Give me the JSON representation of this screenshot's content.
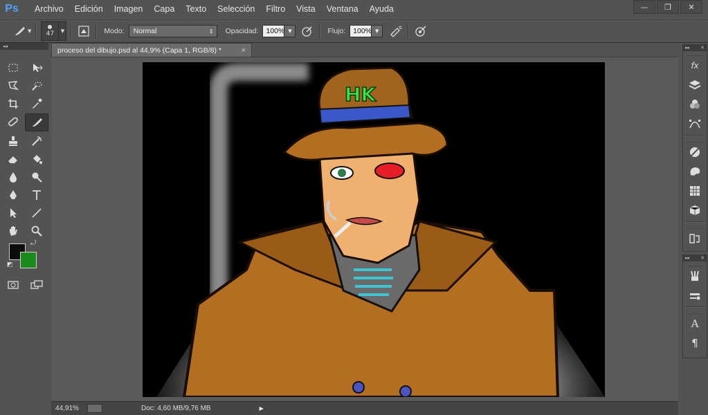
{
  "app": {
    "logo": "Ps"
  },
  "menu": [
    "Archivo",
    "Edición",
    "Imagen",
    "Capa",
    "Texto",
    "Selección",
    "Filtro",
    "Vista",
    "Ventana",
    "Ayuda"
  ],
  "window_controls": {
    "minimize": "—",
    "restore": "❐",
    "close": "✕"
  },
  "options_bar": {
    "brush_size": "47",
    "mode_label": "Modo:",
    "mode_value": "Normal",
    "opacity_label": "Opacidad:",
    "opacity_value": "100%",
    "flow_label": "Flujo:",
    "flow_value": "100%"
  },
  "document_tab": {
    "title": "proceso del dibujo.psd al 44,9% (Capa 1, RGB/8) *",
    "close": "×"
  },
  "colors": {
    "foreground": "#0c0c0c",
    "background": "#1c8a1c",
    "ps_blue": "#4ea3ff"
  },
  "status_bar": {
    "zoom": "44,91%",
    "doc_info": "Doc: 4,60 MB/9,76 MB",
    "arrow": "▶"
  },
  "artwork": {
    "hat_letters": "HK"
  },
  "right_panel_icons_top": [
    "styles-fx-icon",
    "layers-icon",
    "channels-icon",
    "paths-icon",
    "adjustments-icon",
    "swatches-icon",
    "grid-icon",
    "3d-icon",
    "history-icon"
  ],
  "right_panel_icons_bottom": [
    "brush-presets-icon",
    "clone-source-icon",
    "character-icon",
    "paragraph-icon"
  ],
  "right_panel_text": {
    "character": "A",
    "paragraph": "¶",
    "fx": "fx"
  }
}
